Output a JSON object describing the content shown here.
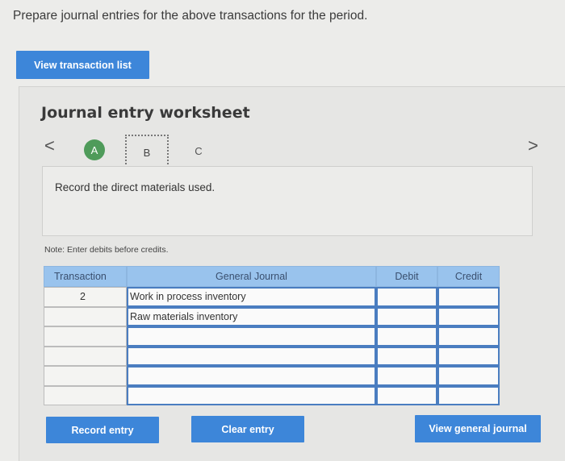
{
  "instruction": "Prepare journal entries for the above transactions for the period.",
  "view_transaction_list_label": "View transaction list",
  "worksheet": {
    "title": "Journal entry worksheet",
    "nav_prev": "<",
    "nav_next": ">",
    "steps": [
      {
        "label": "A",
        "state": "completed"
      },
      {
        "label": "B",
        "state": "current"
      },
      {
        "label": "C",
        "state": "pending"
      }
    ],
    "prompt": "Record the direct materials used.",
    "note": "Note: Enter debits before credits."
  },
  "journal": {
    "headers": {
      "transaction": "Transaction",
      "general_journal": "General Journal",
      "debit": "Debit",
      "credit": "Credit"
    },
    "rows": [
      {
        "transaction": "2",
        "account": "Work in process inventory",
        "debit": "",
        "credit": ""
      },
      {
        "transaction": "",
        "account": "Raw materials inventory",
        "debit": "",
        "credit": ""
      },
      {
        "transaction": "",
        "account": "",
        "debit": "",
        "credit": ""
      },
      {
        "transaction": "",
        "account": "",
        "debit": "",
        "credit": ""
      },
      {
        "transaction": "",
        "account": "",
        "debit": "",
        "credit": ""
      },
      {
        "transaction": "",
        "account": "",
        "debit": "",
        "credit": ""
      }
    ]
  },
  "buttons": {
    "record_entry": "Record entry",
    "clear_entry": "Clear entry",
    "view_general_journal": "View general journal"
  },
  "colors": {
    "button_blue": "#3d86d9",
    "header_blue": "#99c3ed",
    "step_done_green": "#4f9b5a"
  }
}
